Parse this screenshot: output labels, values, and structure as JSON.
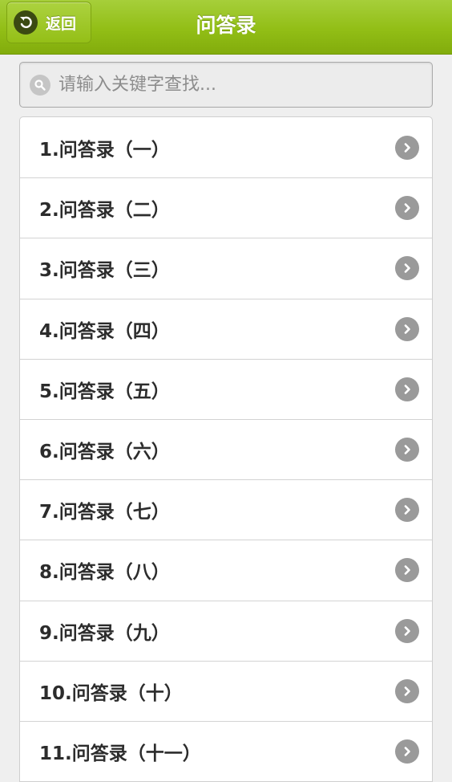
{
  "header": {
    "back_label": "返回",
    "title": "问答录"
  },
  "search": {
    "placeholder": "请输入关键字查找...",
    "value": ""
  },
  "list": {
    "items": [
      {
        "label": "1.问答录（一）"
      },
      {
        "label": "2.问答录（二）"
      },
      {
        "label": "3.问答录（三）"
      },
      {
        "label": "4.问答录（四）"
      },
      {
        "label": "5.问答录（五）"
      },
      {
        "label": "6.问答录（六）"
      },
      {
        "label": "7.问答录（七）"
      },
      {
        "label": "8.问答录（八）"
      },
      {
        "label": "9.问答录（九）"
      },
      {
        "label": "10.问答录（十）"
      },
      {
        "label": "11.问答录（十一）"
      }
    ]
  },
  "icons": {
    "back": "back-arrow-icon",
    "search": "search-icon",
    "chevron": "chevron-right-icon"
  },
  "colors": {
    "header_green": "#92be16",
    "chevron_gray": "#9a9a9a"
  }
}
